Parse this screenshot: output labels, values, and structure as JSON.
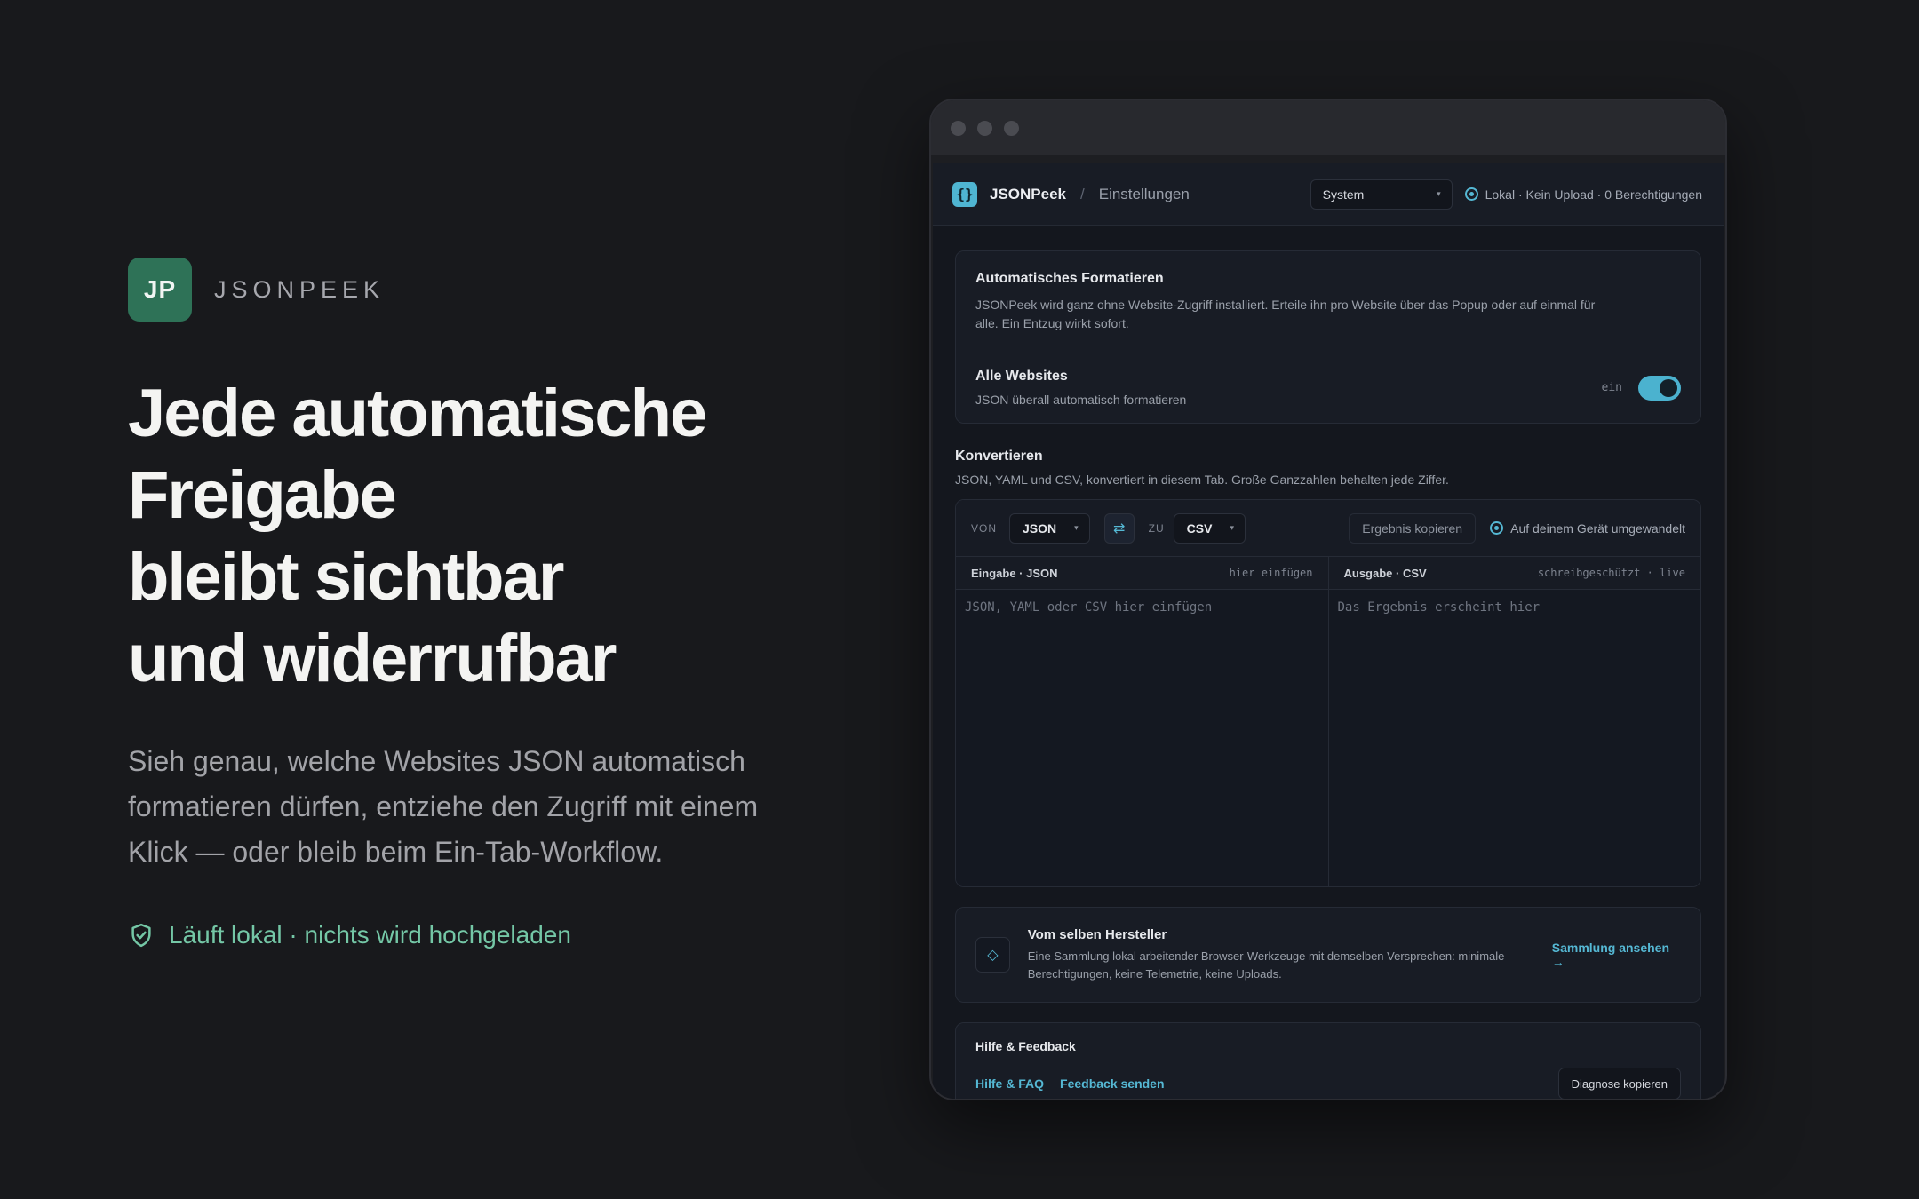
{
  "hero": {
    "logo_initials": "JP",
    "brand": "JSONPEEK",
    "headline": [
      "Jede automatische",
      "Freigabe",
      "bleibt sichtbar",
      "und widerrufbar"
    ],
    "subtitle": "Sieh genau, welche Websites JSON automatisch formatieren dürfen, entziehe den Zugriff mit einem Klick — oder bleib beim Ein-Tab-Workflow.",
    "local_note": "Läuft lokal · nichts wird hochgeladen"
  },
  "app": {
    "icon": "{}",
    "name": "JSONPeek",
    "separator": "/",
    "breadcrumb": "Einstellungen",
    "theme_select": "System",
    "status": "Lokal · Kein Upload · 0 Berechtigungen"
  },
  "auto_format": {
    "title": "Automatisches Formatieren",
    "description": "JSONPeek wird ganz ohne Website-Zugriff installiert. Erteile ihn pro Website über das Popup oder auf einmal für alle. Ein Entzug wirkt sofort.",
    "all_sites_title": "Alle Websites",
    "all_sites_sub": "JSON überall automatisch formatieren",
    "toggle_label": "ein",
    "toggle_on": true
  },
  "convert": {
    "title": "Konvertieren",
    "subtitle": "JSON, YAML und CSV, konvertiert in diesem Tab. Große Ganzzahlen behalten jede Ziffer.",
    "from_label": "VON",
    "from_value": "JSON",
    "swap_icon": "⇄",
    "to_label": "ZU",
    "to_value": "CSV",
    "copy_result": "Ergebnis kopieren",
    "local_conv": "Auf deinem Gerät umgewandelt",
    "input_title": "Eingabe · JSON",
    "input_hint": "hier einfügen",
    "input_placeholder": "JSON, YAML oder CSV hier einfügen",
    "output_title": "Ausgabe · CSV",
    "output_hint": "schreibgeschützt · live",
    "output_placeholder": "Das Ergebnis erscheint hier"
  },
  "maker": {
    "icon": "◇",
    "title": "Vom selben Hersteller",
    "description": "Eine Sammlung lokal arbeitender Browser-Werkzeuge mit demselben Versprechen: minimale Berechtigungen, keine Telemetrie, keine Uploads.",
    "link": "Sammlung ansehen →"
  },
  "help": {
    "title": "Hilfe & Feedback",
    "faq": "Hilfe & FAQ",
    "feedback": "Feedback senden",
    "diagnose": "Diagnose kopieren"
  },
  "colors": {
    "accent": "#55b8d4",
    "brand_green": "#2e7257",
    "local_green": "#74c7a6"
  }
}
